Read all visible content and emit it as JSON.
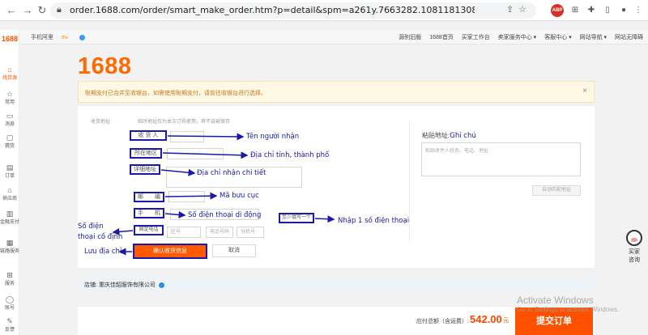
{
  "browser": {
    "url": "order.1688.com/order/smart_make_order.htm?p=detail&spm=a261y.7663282.10811813088311.i2.6b5f28e2cAUosi&pre-spm=a26352.13...",
    "ext_badge": "ABP"
  },
  "sidebar": {
    "logo": "1688",
    "items": [
      {
        "label": "找货源",
        "icon": "home-icon"
      },
      {
        "label": "常用",
        "icon": "star-icon"
      },
      {
        "label": "消息",
        "icon": "message-icon"
      },
      {
        "label": "猜货",
        "icon": "box-icon"
      },
      {
        "label": "订单",
        "icon": "order-icon"
      },
      {
        "label": "供应商",
        "icon": "store-icon"
      },
      {
        "label": "金融支付",
        "icon": "finance-icon"
      },
      {
        "label": "链路服务",
        "icon": "service-icon"
      },
      {
        "label": "服务",
        "icon": "grid-icon"
      },
      {
        "label": "账号",
        "icon": "user-icon"
      },
      {
        "label": "反馈",
        "icon": "feedback-icon"
      }
    ]
  },
  "topnav": {
    "left": "手机阿里",
    "left_tag": "thx",
    "right": [
      "源别旧版",
      "1688首页",
      "买家工作台",
      "卖家服务中心 ▾",
      "客服中心 ▾",
      "网站导航 ▾",
      "网站无障碍"
    ]
  },
  "logo": "1688",
  "notice": {
    "text": "账期支付已合并至收银台，如需使用账期支付，请前往收银台进行选择。",
    "close": "×"
  },
  "form": {
    "section_title": "收货地址:",
    "hint": "临时地址仅为本次订购使用，将不会被保存",
    "recipient_label": "收 货 人",
    "region_label": "所在地区",
    "address_label": "详细地址",
    "postal_label": "邮　　编",
    "mobile_label": "手　　机",
    "landline_label": "固定电话",
    "phone_prompt": "至少填写一个",
    "area_code_placeholder": "区号",
    "phone_placeholder": "电话号码",
    "ext_placeholder": "分机号",
    "confirm_button": "确认收货信息",
    "cancel_button": "取消"
  },
  "annotations": {
    "recipient": "Tên người nhận",
    "region": "Địa chỉ tỉnh, thành phố",
    "address": "Địa chỉ nhận chi tiết",
    "postal": "Mã bưu cục",
    "mobile": "Số điện thoại di động",
    "phone_prompt": "Nhập 1 số điện thoại",
    "landline_line1": "Số điện",
    "landline_line2": "thoại cố định",
    "save": "Lưu địa chỉ",
    "note": "Ghi chú"
  },
  "paste_panel": {
    "title": "粘贴地址:",
    "placeholder": "粘贴收件人姓名、电话、地址",
    "auto_button": "自动匹配地址"
  },
  "shop": {
    "label": "店铺: 重庆佳韶服饰有限公司"
  },
  "footer": {
    "total_label": "应付总额（含运费）:",
    "total_amount": "542.00",
    "currency": "元",
    "submit_button": "提交订单"
  },
  "watermark": {
    "line1": "Activate Windows",
    "line2": "Go to Settings to activate Windows."
  },
  "float_help": {
    "label": "买家\n咨询",
    "line1": "买家",
    "line2": "咨询"
  },
  "colors": {
    "accent": "#ff5000",
    "annotation": "#1818a0"
  }
}
